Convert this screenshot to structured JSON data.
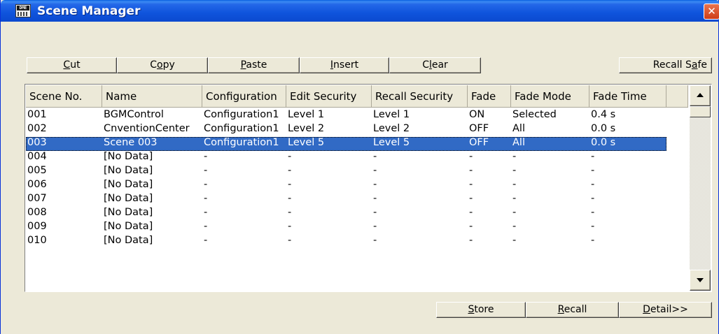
{
  "window": {
    "title": "Scene Manager",
    "app_icon": "dme-app-icon",
    "app_icon_text": "DME",
    "close_label": "✕"
  },
  "toolbar": {
    "cut": {
      "pre": "",
      "key": "C",
      "post": "ut"
    },
    "copy": {
      "pre": "C",
      "key": "o",
      "post": "py"
    },
    "paste": {
      "pre": "",
      "key": "P",
      "post": "aste"
    },
    "insert": {
      "pre": "",
      "key": "I",
      "post": "nsert"
    },
    "clear": {
      "pre": "C",
      "key": "l",
      "post": "ear"
    },
    "recall_safe": {
      "pre": "Recall S",
      "key": "a",
      "post": "fe"
    }
  },
  "table": {
    "columns": [
      "Scene No.",
      "Name",
      "Configuration",
      "Edit Security",
      "Recall Security",
      "Fade",
      "Fade Mode",
      "Fade Time"
    ],
    "selected_index": 2,
    "rows": [
      [
        "001",
        "BGMControl",
        "Configuration1",
        "Level 1",
        "Level 1",
        "ON",
        "Selected",
        "0.4 s"
      ],
      [
        "002",
        "CnventionCenter",
        "Configuration1",
        "Level 2",
        "Level 2",
        "OFF",
        "All",
        "0.0 s"
      ],
      [
        "003",
        "Scene 003",
        "Configuration1",
        "Level 5",
        "Level 5",
        "OFF",
        "All",
        "0.0 s"
      ],
      [
        "004",
        "[No Data]",
        "-",
        "-",
        "-",
        "-",
        "-",
        "-"
      ],
      [
        "005",
        "[No Data]",
        "-",
        "-",
        "-",
        "-",
        "-",
        "-"
      ],
      [
        "006",
        "[No Data]",
        "-",
        "-",
        "-",
        "-",
        "-",
        "-"
      ],
      [
        "007",
        "[No Data]",
        "-",
        "-",
        "-",
        "-",
        "-",
        "-"
      ],
      [
        "008",
        "[No Data]",
        "-",
        "-",
        "-",
        "-",
        "-",
        "-"
      ],
      [
        "009",
        "[No Data]",
        "-",
        "-",
        "-",
        "-",
        "-",
        "-"
      ],
      [
        "010",
        "[No Data]",
        "-",
        "-",
        "-",
        "-",
        "-",
        "-"
      ]
    ]
  },
  "footer": {
    "store": {
      "pre": "",
      "key": "S",
      "post": "tore"
    },
    "recall": {
      "pre": "",
      "key": "R",
      "post": "ecall"
    },
    "detail": {
      "pre": "",
      "key": "D",
      "post": "etail>>"
    }
  },
  "colors": {
    "titlebar": "#0b55dc",
    "selection": "#316ac5",
    "face": "#ece9d8"
  }
}
